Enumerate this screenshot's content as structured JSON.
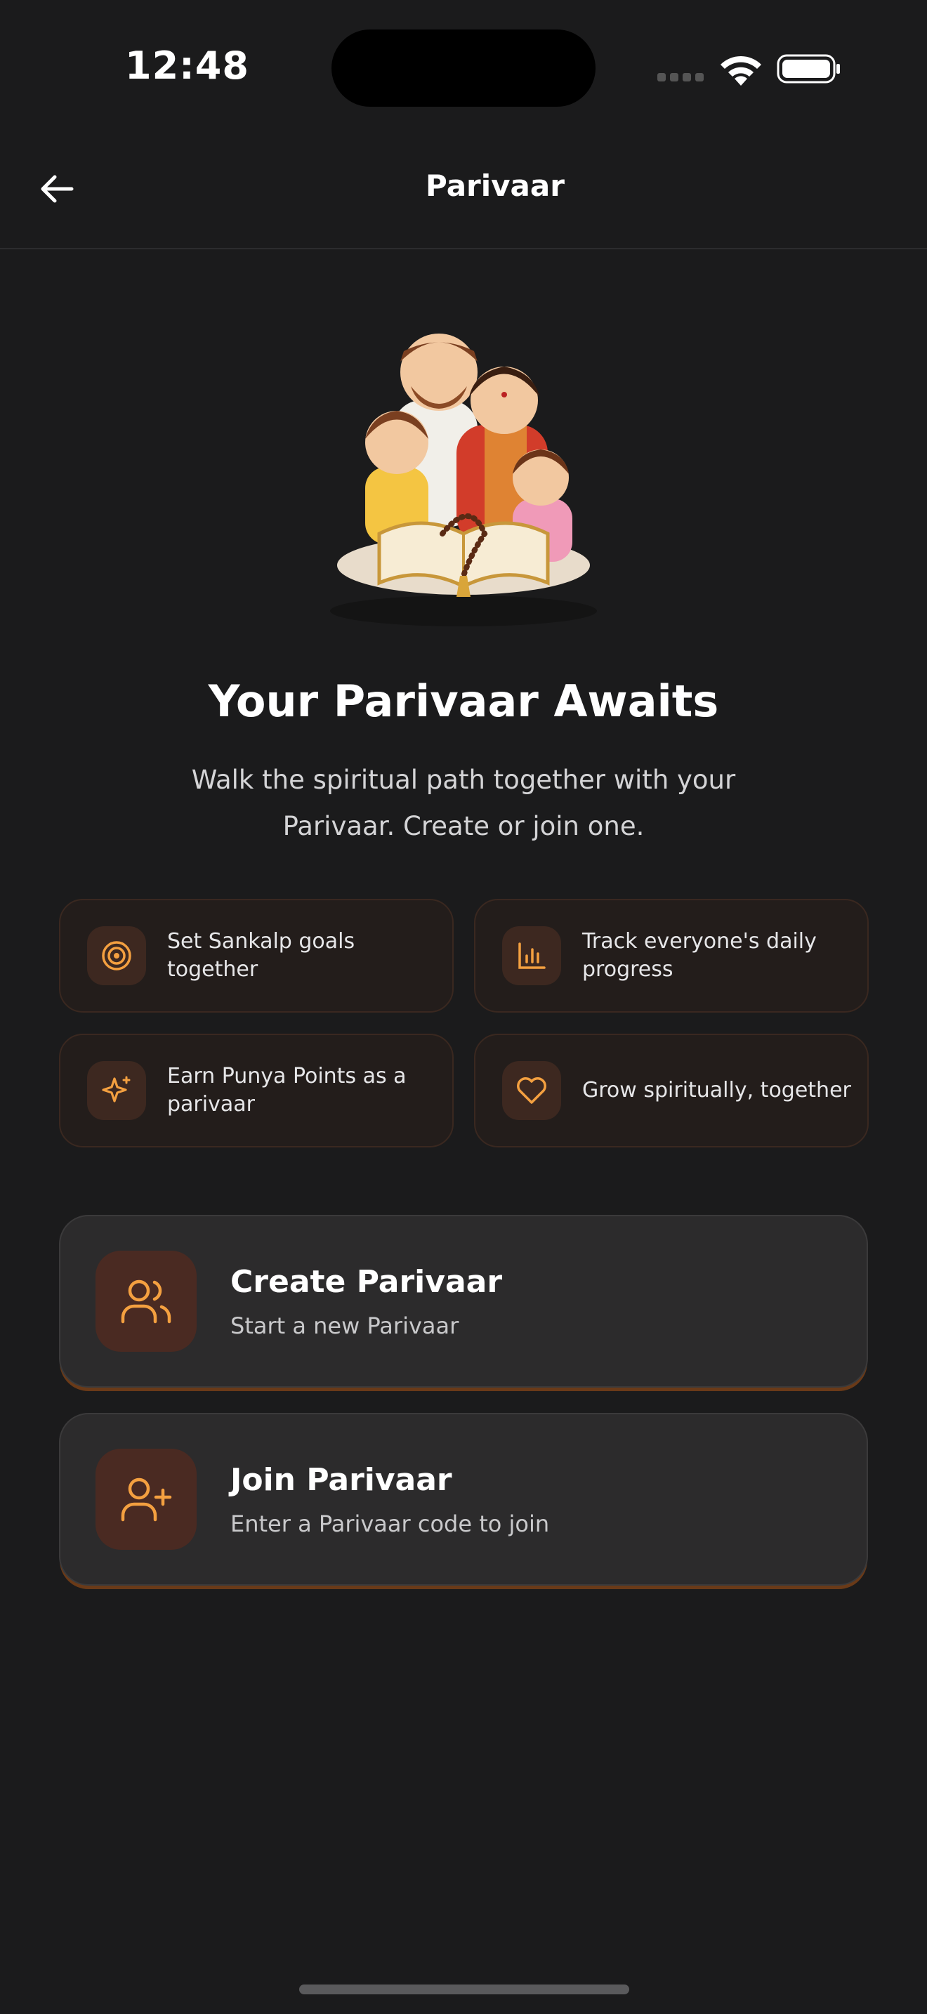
{
  "status_bar": {
    "time": "12:48"
  },
  "header": {
    "title": "Parivaar",
    "back_icon": "arrow-left-icon"
  },
  "hero": {
    "illustration": "family-praying-illustration",
    "title": "Your Parivaar Awaits",
    "subtitle_line1": "Walk the spiritual path together with your",
    "subtitle_line2": "Parivaar. Create or join one."
  },
  "features": [
    {
      "label": "Set Sankalp goals together",
      "icon": "target-icon"
    },
    {
      "label": "Track everyone's daily progress",
      "icon": "bar-chart-icon"
    },
    {
      "label": "Earn Punya Points as a parivaar",
      "icon": "sparkle-icon"
    },
    {
      "label": "Grow spiritually, together",
      "icon": "heart-icon"
    }
  ],
  "actions": {
    "create": {
      "title": "Create Parivaar",
      "subtitle": "Start a new Parivaar",
      "icon": "users-icon"
    },
    "join": {
      "title": "Join Parivaar",
      "subtitle": "Enter a Parivaar code to join",
      "icon": "user-plus-icon"
    }
  },
  "colors": {
    "background": "#1b1b1c",
    "accent": "#f4a040",
    "card": "#2c2b2c",
    "feature_card": "#231d1b"
  }
}
